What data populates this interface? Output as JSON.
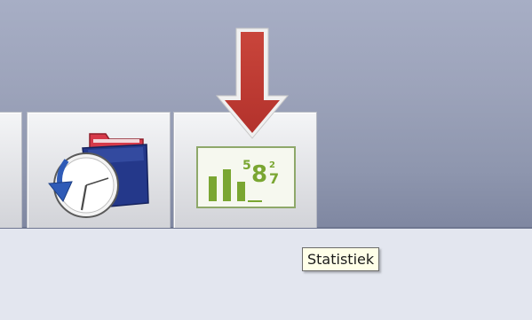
{
  "toolbar": {
    "buttons": [
      {
        "name": "partial",
        "icon": "partial-button"
      },
      {
        "name": "history",
        "icon": "history-folder-clock-icon"
      },
      {
        "name": "statistics",
        "icon": "statistics-chart-icon"
      }
    ],
    "stats_icon_digits": {
      "a": "5",
      "b": "8",
      "c": "2",
      "d": "7"
    }
  },
  "tooltip": {
    "text": "Statistiek"
  },
  "annotation": {
    "icon": "down-arrow-icon",
    "color": "#c0392b"
  },
  "colors": {
    "stats_green": "#7aa632",
    "folder_red": "#d63a4a",
    "folder_blue": "#2a3e8c",
    "arrow_blue": "#2f5bb7"
  }
}
